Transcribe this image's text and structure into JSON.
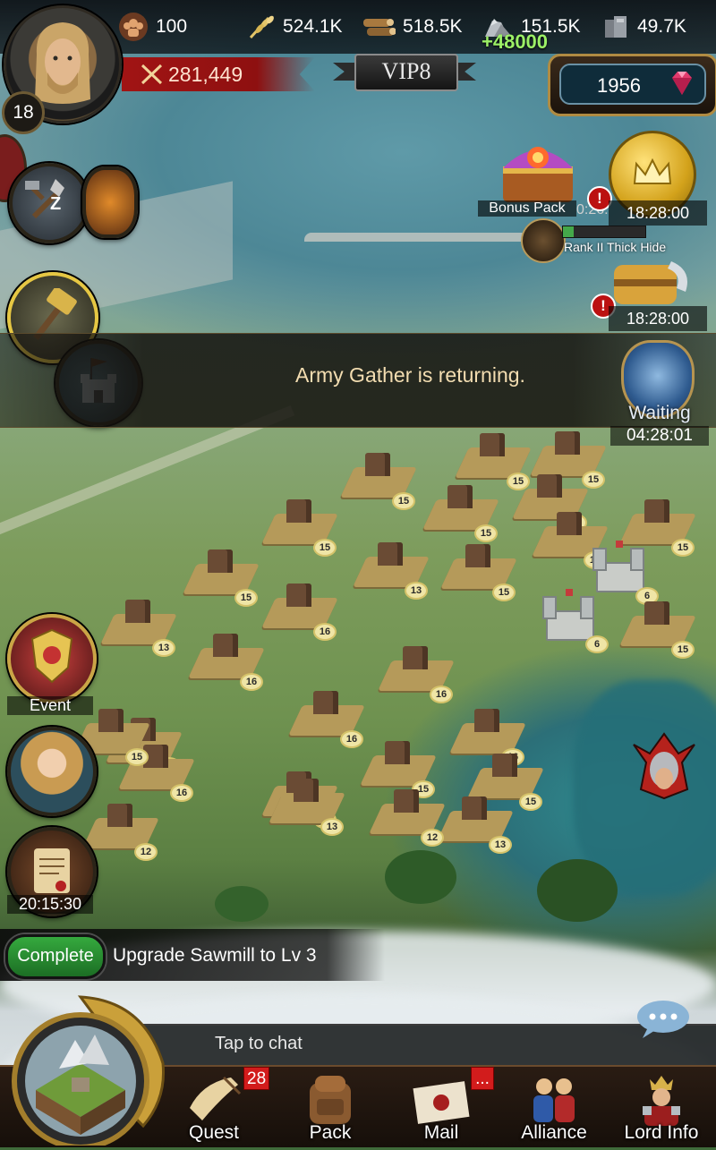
{
  "resources": {
    "troops": "100",
    "food": "524.1K",
    "wood": "518.5K",
    "stone": "151.5K",
    "stone_gain": "+48000",
    "ore": "49.7K"
  },
  "lord": {
    "level": "18",
    "power": "281,449",
    "vip": "VIP8"
  },
  "gems": "1956",
  "offers": {
    "bonus_pack_label": "Bonus Pack",
    "bonus_pack_timer": "0:26:",
    "gold_timer": "18:28:00",
    "chest_timer": "18:28:00",
    "rank_item": "Rank II Thick Hide"
  },
  "banner": {
    "message": "Army Gather is returning.",
    "status": "Waiting",
    "timer": "04:28:01"
  },
  "map_levels": [
    "15",
    "15",
    "15",
    "15",
    "15",
    "15",
    "15",
    "13",
    "15",
    "15",
    "15",
    "16",
    "13",
    "6",
    "16",
    "6",
    "15",
    "16",
    "16",
    "16",
    "16",
    "15",
    "12",
    "15",
    "16",
    "12",
    "13",
    "13",
    "12",
    "15"
  ],
  "sidebar": {
    "event_label": "Event",
    "quest_timer": "20:15:30"
  },
  "quest": {
    "button": "Complete",
    "text": "Upgrade  Sawmill  to Lv 3"
  },
  "chat": {
    "placeholder": "Tap to chat"
  },
  "nav": [
    {
      "label": "Quest",
      "badge": "28"
    },
    {
      "label": "Pack"
    },
    {
      "label": "Mail",
      "badge": "..."
    },
    {
      "label": "Alliance"
    },
    {
      "label": "Lord Info"
    }
  ],
  "colors": {
    "power_red": "#a11414",
    "gain_green": "#9cf066",
    "complete_green": "#35a93e",
    "badge_red": "#d21c1c"
  }
}
